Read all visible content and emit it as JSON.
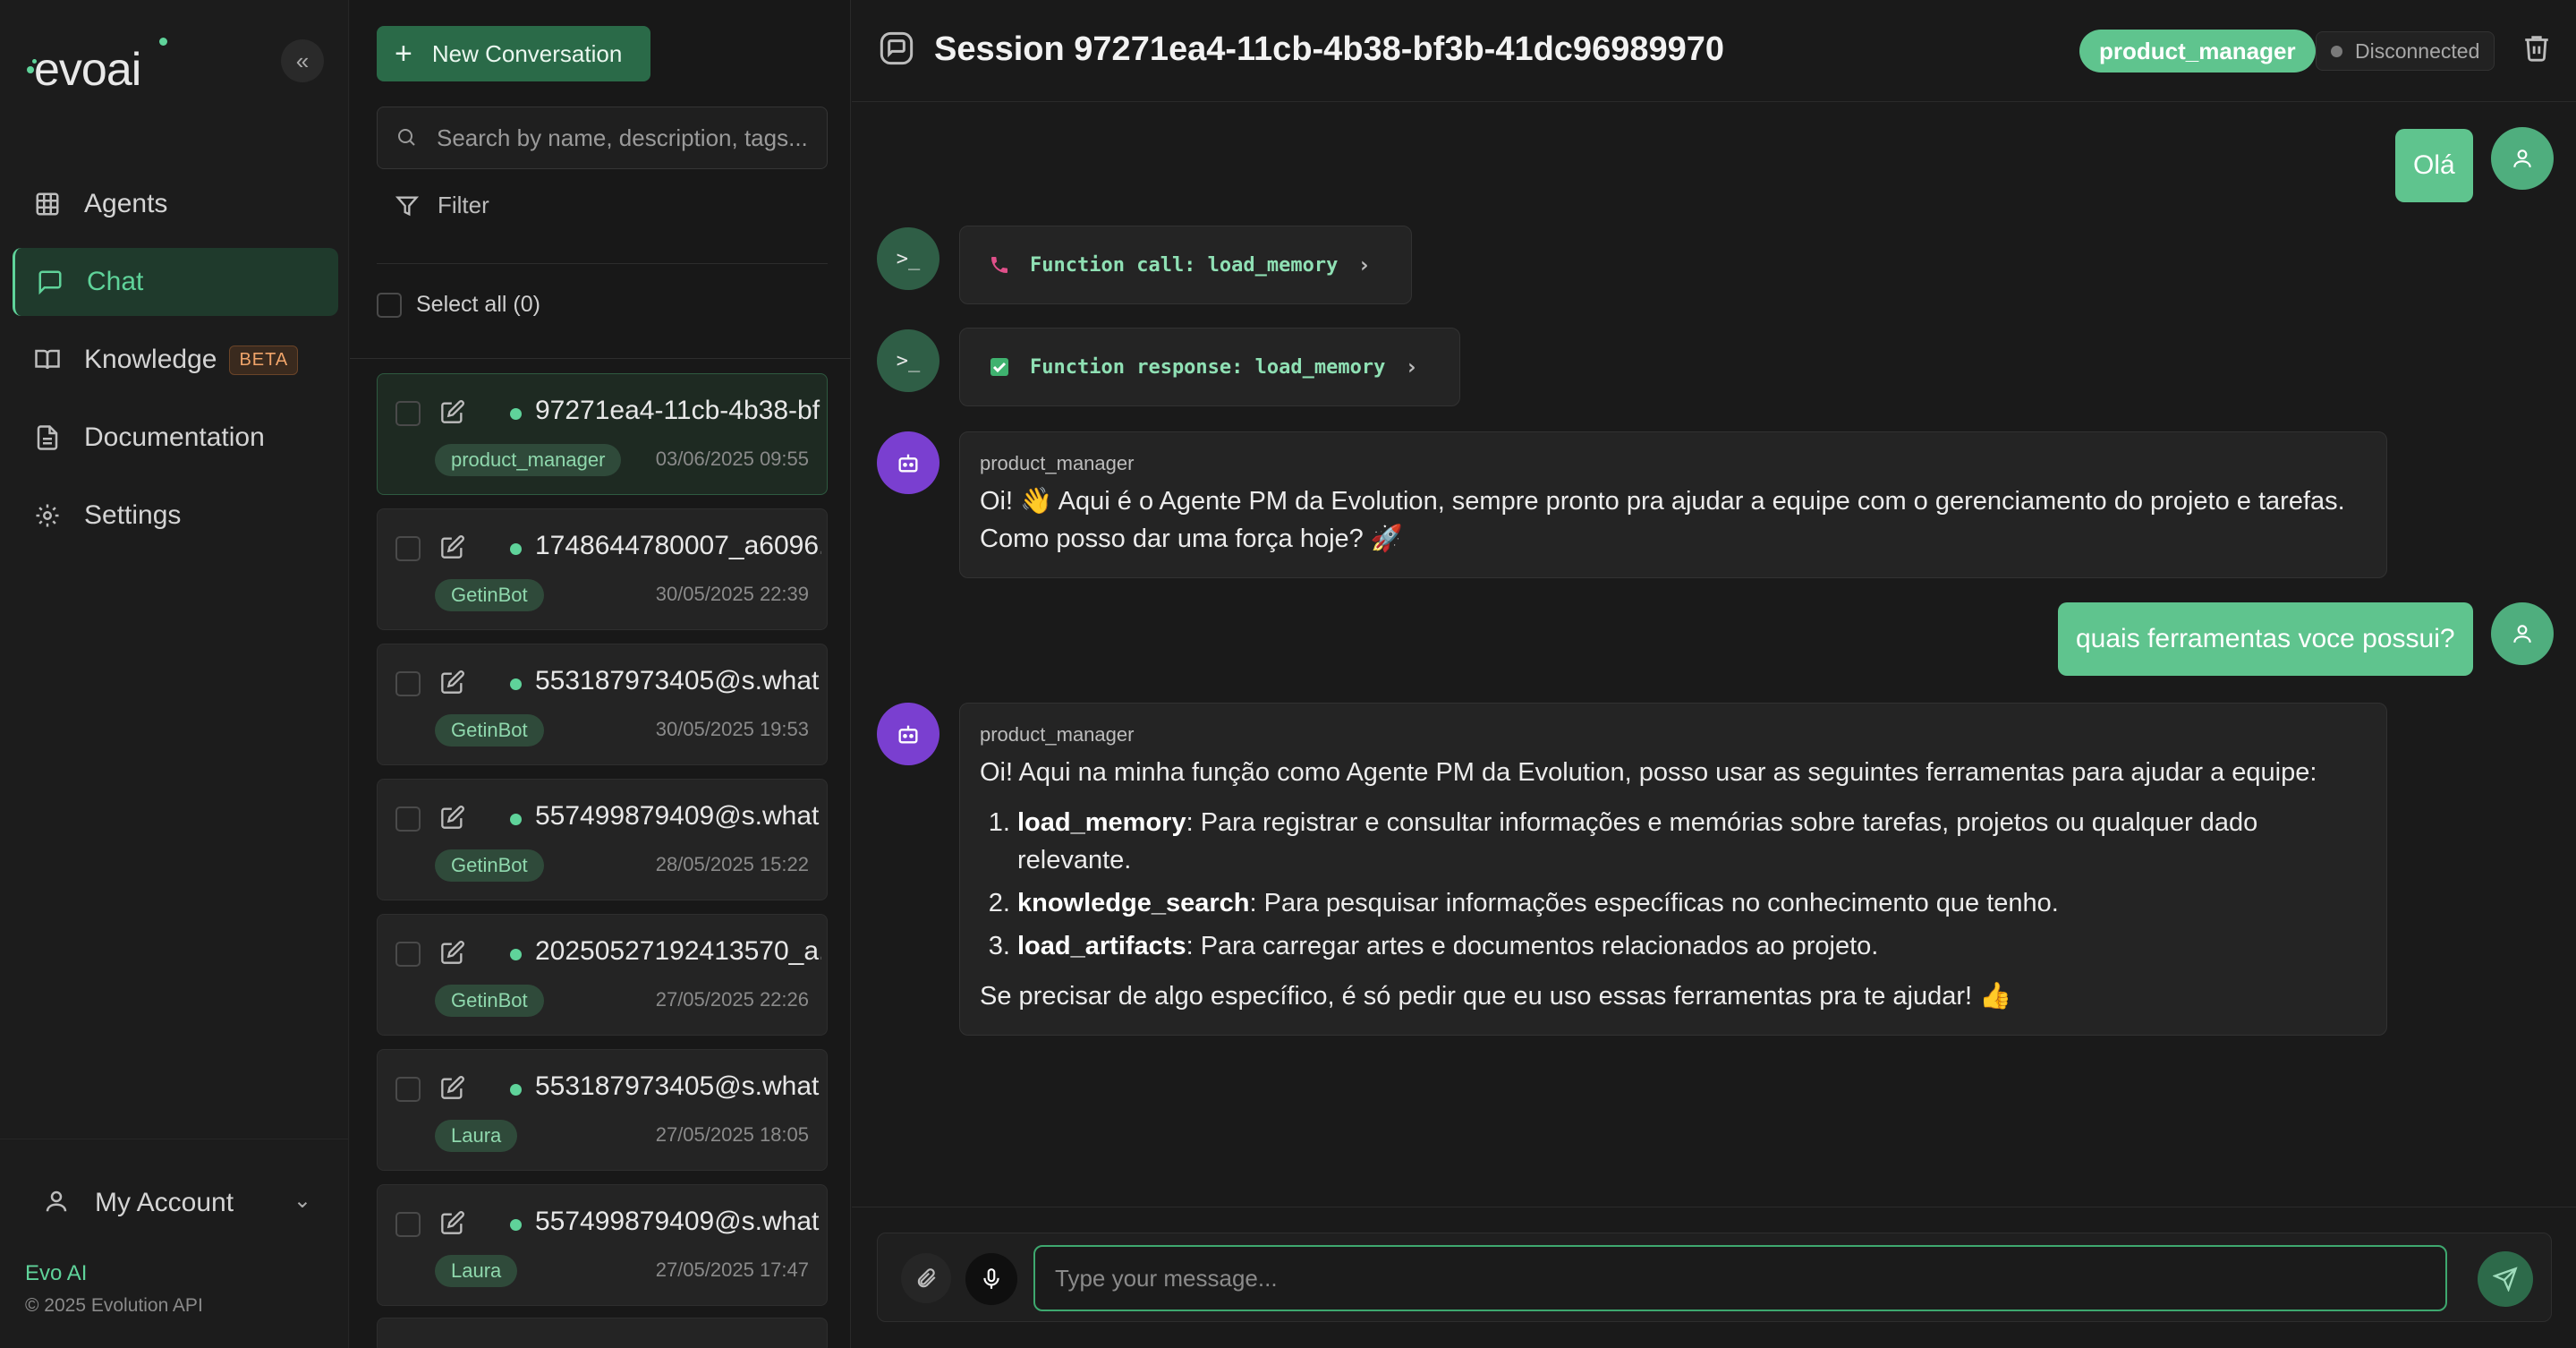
{
  "sidebar": {
    "logo": "evoai",
    "nav": [
      {
        "label": "Agents",
        "icon": "grid-icon"
      },
      {
        "label": "Chat",
        "icon": "chat-icon",
        "active": true
      },
      {
        "label": "Knowledge",
        "icon": "book-icon",
        "badge": "BETA"
      },
      {
        "label": "Documentation",
        "icon": "document-icon"
      },
      {
        "label": "Settings",
        "icon": "gear-icon"
      }
    ],
    "account_label": "My Account",
    "brand": "Evo AI",
    "copyright": "© 2025 Evolution API"
  },
  "conversations": {
    "new_button": "New Conversation",
    "search_placeholder": "Search by name, description, tags...",
    "filter_label": "Filter",
    "select_all": "Select all (0)",
    "items": [
      {
        "name": "97271ea4-11cb-4b38-bf...",
        "tag": "product_manager",
        "date": "03/06/2025 09:55",
        "active": true
      },
      {
        "name": "1748644780007_a6096...",
        "tag": "GetinBot",
        "date": "30/05/2025 22:39"
      },
      {
        "name": "553187973405@s.what...",
        "tag": "GetinBot",
        "date": "30/05/2025 19:53"
      },
      {
        "name": "557499879409@s.what...",
        "tag": "GetinBot",
        "date": "28/05/2025 15:22"
      },
      {
        "name": "20250527192413570_a...",
        "tag": "GetinBot",
        "date": "27/05/2025 22:26"
      },
      {
        "name": "553187973405@s.what...",
        "tag": "Laura",
        "date": "27/05/2025 18:05"
      },
      {
        "name": "557499879409@s.what...",
        "tag": "Laura",
        "date": "27/05/2025 17:47"
      }
    ]
  },
  "header": {
    "title": "Session 97271ea4-11cb-4b38-bf3b-41dc96989970",
    "agent_badge": "product_manager",
    "status": "Disconnected"
  },
  "messages": {
    "user1": "Olá",
    "fn_call": "Function call: load_memory",
    "fn_response": "Function response: load_memory",
    "bot1_name": "product_manager",
    "bot1_text": "Oi! 👋 Aqui é o Agente PM da Evolution, sempre pronto pra ajudar a equipe com o gerenciamento do projeto e tarefas. Como posso dar uma força hoje? 🚀",
    "user2": "quais ferramentas voce possui?",
    "bot2_name": "product_manager",
    "bot2_intro": "Oi! Aqui na minha função como Agente PM da Evolution, posso usar as seguintes ferramentas para ajudar a equipe:",
    "bot2_items": [
      {
        "tool": "load_memory",
        "desc": ": Para registrar e consultar informações e memórias sobre tarefas, projetos ou qualquer dado relevante."
      },
      {
        "tool": "knowledge_search",
        "desc": ": Para pesquisar informações específicas no conhecimento que tenho."
      },
      {
        "tool": "load_artifacts",
        "desc": ": Para carregar artes e documentos relacionados ao projeto."
      }
    ],
    "bot2_outro": "Se precisar de algo específico, é só pedir que eu uso essas ferramentas pra te ajudar! 👍"
  },
  "composer": {
    "placeholder": "Type your message..."
  },
  "colors": {
    "accent": "#5fc48e",
    "bot_avatar": "#7a3fd0",
    "background": "#1a1a1a"
  }
}
